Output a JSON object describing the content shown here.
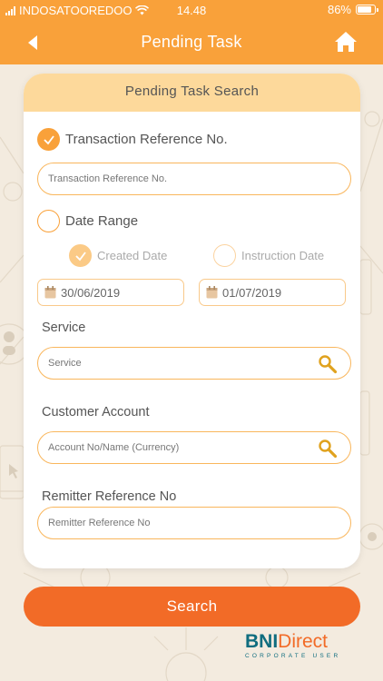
{
  "status_bar": {
    "carrier": "INDOSATOOREDOO",
    "time": "14.48",
    "battery": "86%"
  },
  "header": {
    "title": "Pending Task",
    "back_icon": "back-arrow-icon",
    "home_icon": "home-icon"
  },
  "form": {
    "title": "Pending Task Search",
    "transaction_ref": {
      "label": "Transaction Reference No.",
      "checked": true,
      "placeholder": "Transaction Reference No."
    },
    "date_range": {
      "label": "Date Range",
      "checked": false,
      "created_date_label": "Created Date",
      "instruction_date_label": "Instruction Date",
      "from": "30/06/2019",
      "to": "01/07/2019"
    },
    "service": {
      "label": "Service",
      "placeholder": "Service"
    },
    "customer_account": {
      "label": "Customer Account",
      "placeholder": "Account No/Name (Currency)"
    },
    "remitter_ref": {
      "label": "Remitter Reference No",
      "placeholder": "Remitter Reference No"
    },
    "search_label": "Search"
  },
  "brand": {
    "name_bold": "BNI",
    "name_light": "Direct",
    "tagline": "CORPORATE USER"
  },
  "colors": {
    "primary": "#f9a13a",
    "action": "#f26b27",
    "card_header": "#fdd99b",
    "brand_teal": "#0f6d7f"
  }
}
